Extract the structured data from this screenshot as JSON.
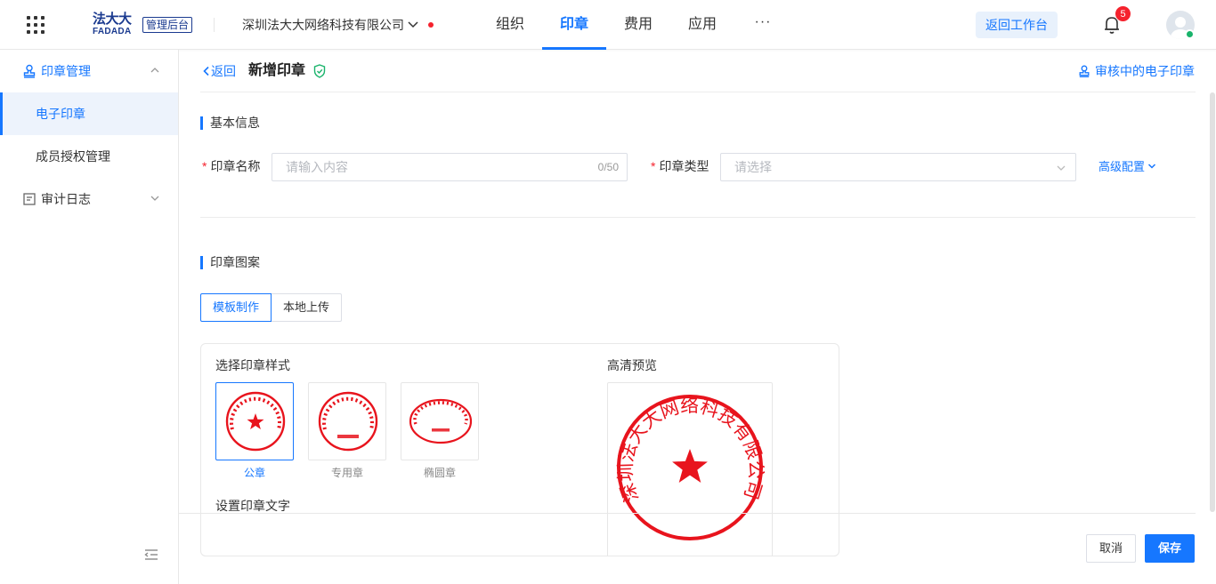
{
  "header": {
    "logo_zh": "法大大",
    "logo_en": "FADADA",
    "admin_badge": "管理后台",
    "company": "深圳法大大网络科技有限公司",
    "nav": [
      {
        "label": "组织"
      },
      {
        "label": "印章"
      },
      {
        "label": "费用"
      },
      {
        "label": "应用"
      }
    ],
    "nav_more": "···",
    "active_nav": "印章",
    "back_workbench": "返回工作台",
    "notification_count": "5"
  },
  "sidebar": {
    "groups": [
      {
        "label": "印章管理",
        "icon": "stamp-icon",
        "expanded": true,
        "items": [
          {
            "label": "电子印章",
            "active": true
          },
          {
            "label": "成员授权管理",
            "active": false
          }
        ]
      },
      {
        "label": "审计日志",
        "icon": "log-icon",
        "expanded": false,
        "items": []
      }
    ]
  },
  "page": {
    "back_label": "返回",
    "title": "新增印章",
    "review_link": "审核中的电子印章"
  },
  "basic_info": {
    "title": "基本信息",
    "name_label": "印章名称",
    "name_value": "",
    "name_placeholder": "请输入内容",
    "name_count": "0/50",
    "type_label": "印章类型",
    "type_placeholder": "请选择",
    "advanced": "高级配置"
  },
  "pattern": {
    "title": "印章图案",
    "tabs": [
      {
        "label": "模板制作",
        "active": true
      },
      {
        "label": "本地上传",
        "active": false
      }
    ],
    "style_title": "选择印章样式",
    "styles": [
      {
        "label": "公章",
        "active": true
      },
      {
        "label": "专用章",
        "active": false
      },
      {
        "label": "椭圆章",
        "active": false
      }
    ],
    "set_text_title": "设置印章文字",
    "preview_title": "高清预览",
    "preview_text": "深圳法大大网络科技有限公司"
  },
  "footer": {
    "cancel": "取消",
    "save": "保存"
  },
  "colors": {
    "accent": "#1677ff",
    "stamp_red": "#e8141d",
    "badge_red": "#f5222d"
  }
}
